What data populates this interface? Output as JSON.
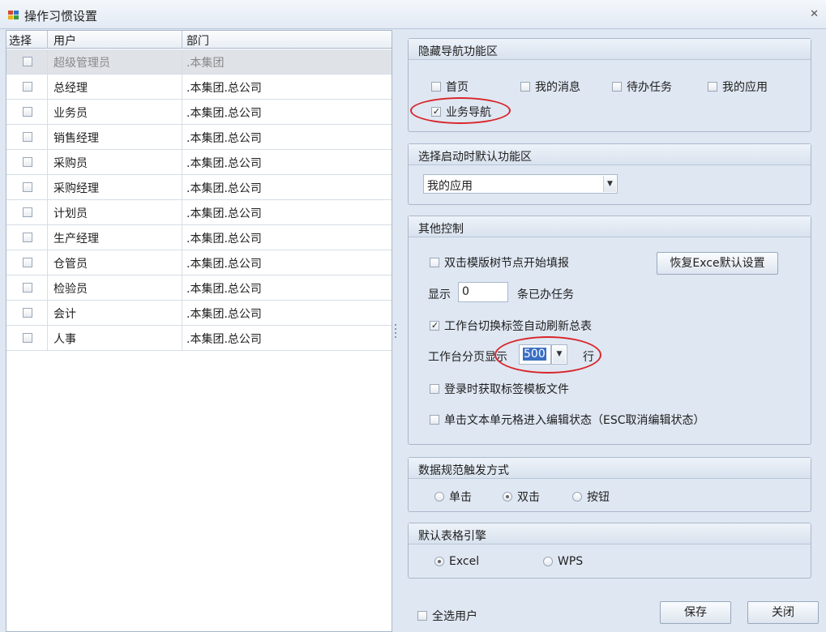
{
  "window": {
    "title": "操作习惯设置",
    "close_glyph": "✕"
  },
  "grid": {
    "columns": [
      "选择",
      "用户",
      "部门"
    ],
    "rows": [
      {
        "user": "超级管理员",
        "dept": ".本集团",
        "disabled": true,
        "checked": false
      },
      {
        "user": "总经理",
        "dept": ".本集团.总公司",
        "checked": false
      },
      {
        "user": "业务员",
        "dept": ".本集团.总公司",
        "checked": false
      },
      {
        "user": "销售经理",
        "dept": ".本集团.总公司",
        "checked": false
      },
      {
        "user": "采购员",
        "dept": ".本集团.总公司",
        "checked": false
      },
      {
        "user": "采购经理",
        "dept": ".本集团.总公司",
        "checked": false
      },
      {
        "user": "计划员",
        "dept": ".本集团.总公司",
        "checked": false
      },
      {
        "user": "生产经理",
        "dept": ".本集团.总公司",
        "checked": false
      },
      {
        "user": "仓管员",
        "dept": ".本集团.总公司",
        "checked": false
      },
      {
        "user": "检验员",
        "dept": ".本集团.总公司",
        "checked": false
      },
      {
        "user": "会计",
        "dept": ".本集团.总公司",
        "checked": false
      },
      {
        "user": "人事",
        "dept": ".本集团.总公司",
        "checked": false
      }
    ]
  },
  "hide_nav": {
    "caption": "隐藏导航功能区",
    "options": [
      {
        "label": "首页",
        "checked": false
      },
      {
        "label": "我的消息",
        "checked": false
      },
      {
        "label": "待办任务",
        "checked": false
      },
      {
        "label": "我的应用",
        "checked": false
      },
      {
        "label": "业务导航",
        "checked": true
      }
    ]
  },
  "startup": {
    "caption": "选择启动时默认功能区",
    "selected": "我的应用"
  },
  "other": {
    "caption": "其他控制",
    "dblclick_template": {
      "label": "双击模版树节点开始填报",
      "checked": false
    },
    "restore_button": "恢复Exce默认设置",
    "show_label": "显示",
    "show_value": "0",
    "show_suffix": "条已办任务",
    "auto_refresh": {
      "label": "工作台切换标签自动刷新总表",
      "checked": true
    },
    "page_label": "工作台分页显示",
    "page_value": "500",
    "page_suffix": "行",
    "login_fetch": {
      "label": "登录时获取标签模板文件",
      "checked": false
    },
    "single_click_edit": {
      "label": "单击文本单元格进入编辑状态（ESC取消编辑状态）",
      "checked": false
    }
  },
  "trigger": {
    "caption": "数据规范触发方式",
    "options": [
      {
        "label": "单击",
        "selected": false
      },
      {
        "label": "双击",
        "selected": true
      },
      {
        "label": "按钮",
        "selected": false
      }
    ]
  },
  "engine": {
    "caption": "默认表格引擎",
    "options": [
      {
        "label": "Excel",
        "selected": true
      },
      {
        "label": "WPS",
        "selected": false
      }
    ]
  },
  "footer": {
    "select_all": "全选用户",
    "save": "保存",
    "close": "关闭"
  },
  "colors": {
    "highlight": "#d8262a",
    "selection": "#3a6fc4"
  }
}
